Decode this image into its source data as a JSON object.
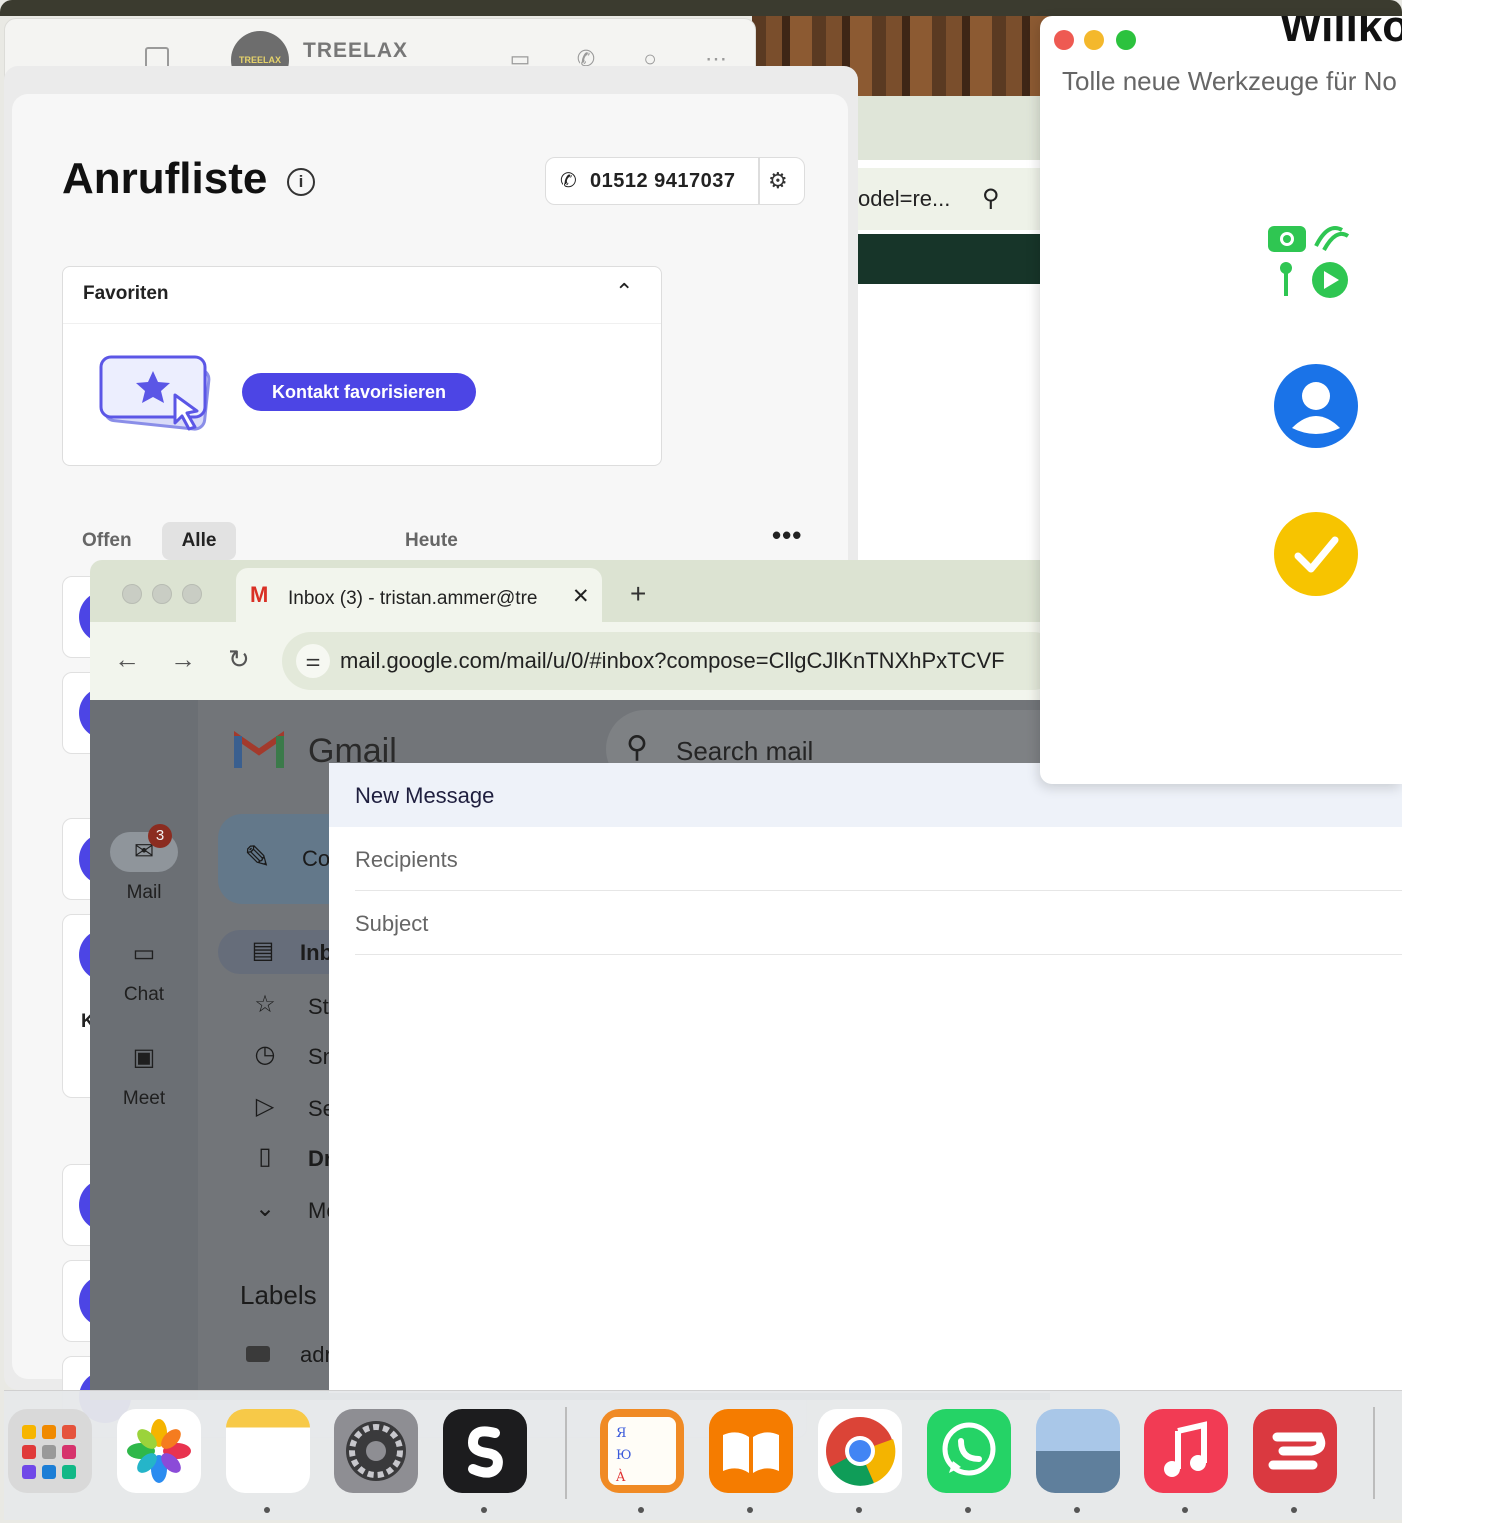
{
  "messenger": {
    "brand": "TREELAX",
    "logo_text": "TREELAX"
  },
  "background_browser": {
    "url_fragment": "odel=re..."
  },
  "call_list": {
    "title": "Anrufliste",
    "info_icon": "info-icon",
    "phone_number": "01512 9417037",
    "favorites": {
      "header": "Favoriten",
      "button": "Kontakt favorisieren"
    },
    "tabs": [
      "Offen",
      "Alle",
      "Heute"
    ],
    "active_tab": "Alle",
    "partial_text": "K"
  },
  "chrome": {
    "tab_title": "Inbox (3) - tristan.ammer@tre",
    "url": "mail.google.com/mail/u/0/#inbox?compose=CllgCJlKnTNXhPxTCVF"
  },
  "gmail": {
    "brand": "Gmail",
    "search_placeholder": "Search mail",
    "rail": [
      {
        "label": "Mail",
        "icon": "mail-icon",
        "badge": "3"
      },
      {
        "label": "Chat",
        "icon": "chat-icon"
      },
      {
        "label": "Meet",
        "icon": "video-icon"
      }
    ],
    "compose_label": "Co",
    "folders": [
      {
        "label": "Inb",
        "icon": "inbox-icon"
      },
      {
        "label": "Sta",
        "icon": "star-icon"
      },
      {
        "label": "Sno",
        "icon": "clock-icon"
      },
      {
        "label": "Sen",
        "icon": "send-icon"
      },
      {
        "label": "Dra",
        "icon": "draft-icon"
      },
      {
        "label": "Mo",
        "icon": "chevron-down-icon"
      }
    ],
    "labels_heading": "Labels",
    "label_1": "adr"
  },
  "compose": {
    "title": "New Message",
    "recipients_placeholder": "Recipients",
    "subject_placeholder": "Subject"
  },
  "welcome": {
    "title": "Willko",
    "subtitle": "Tolle neue Werkzeuge für No"
  },
  "dock": {
    "apps": [
      "Launchpad",
      "Photos",
      "Notes",
      "System Settings",
      "Superhuman",
      "Font Book",
      "Books",
      "Chrome",
      "WhatsApp",
      "Preview",
      "Music",
      "ExpressVPN"
    ]
  },
  "colors": {
    "accent": "#4c45e5",
    "gmail_compose_header": "#eef2f9"
  }
}
